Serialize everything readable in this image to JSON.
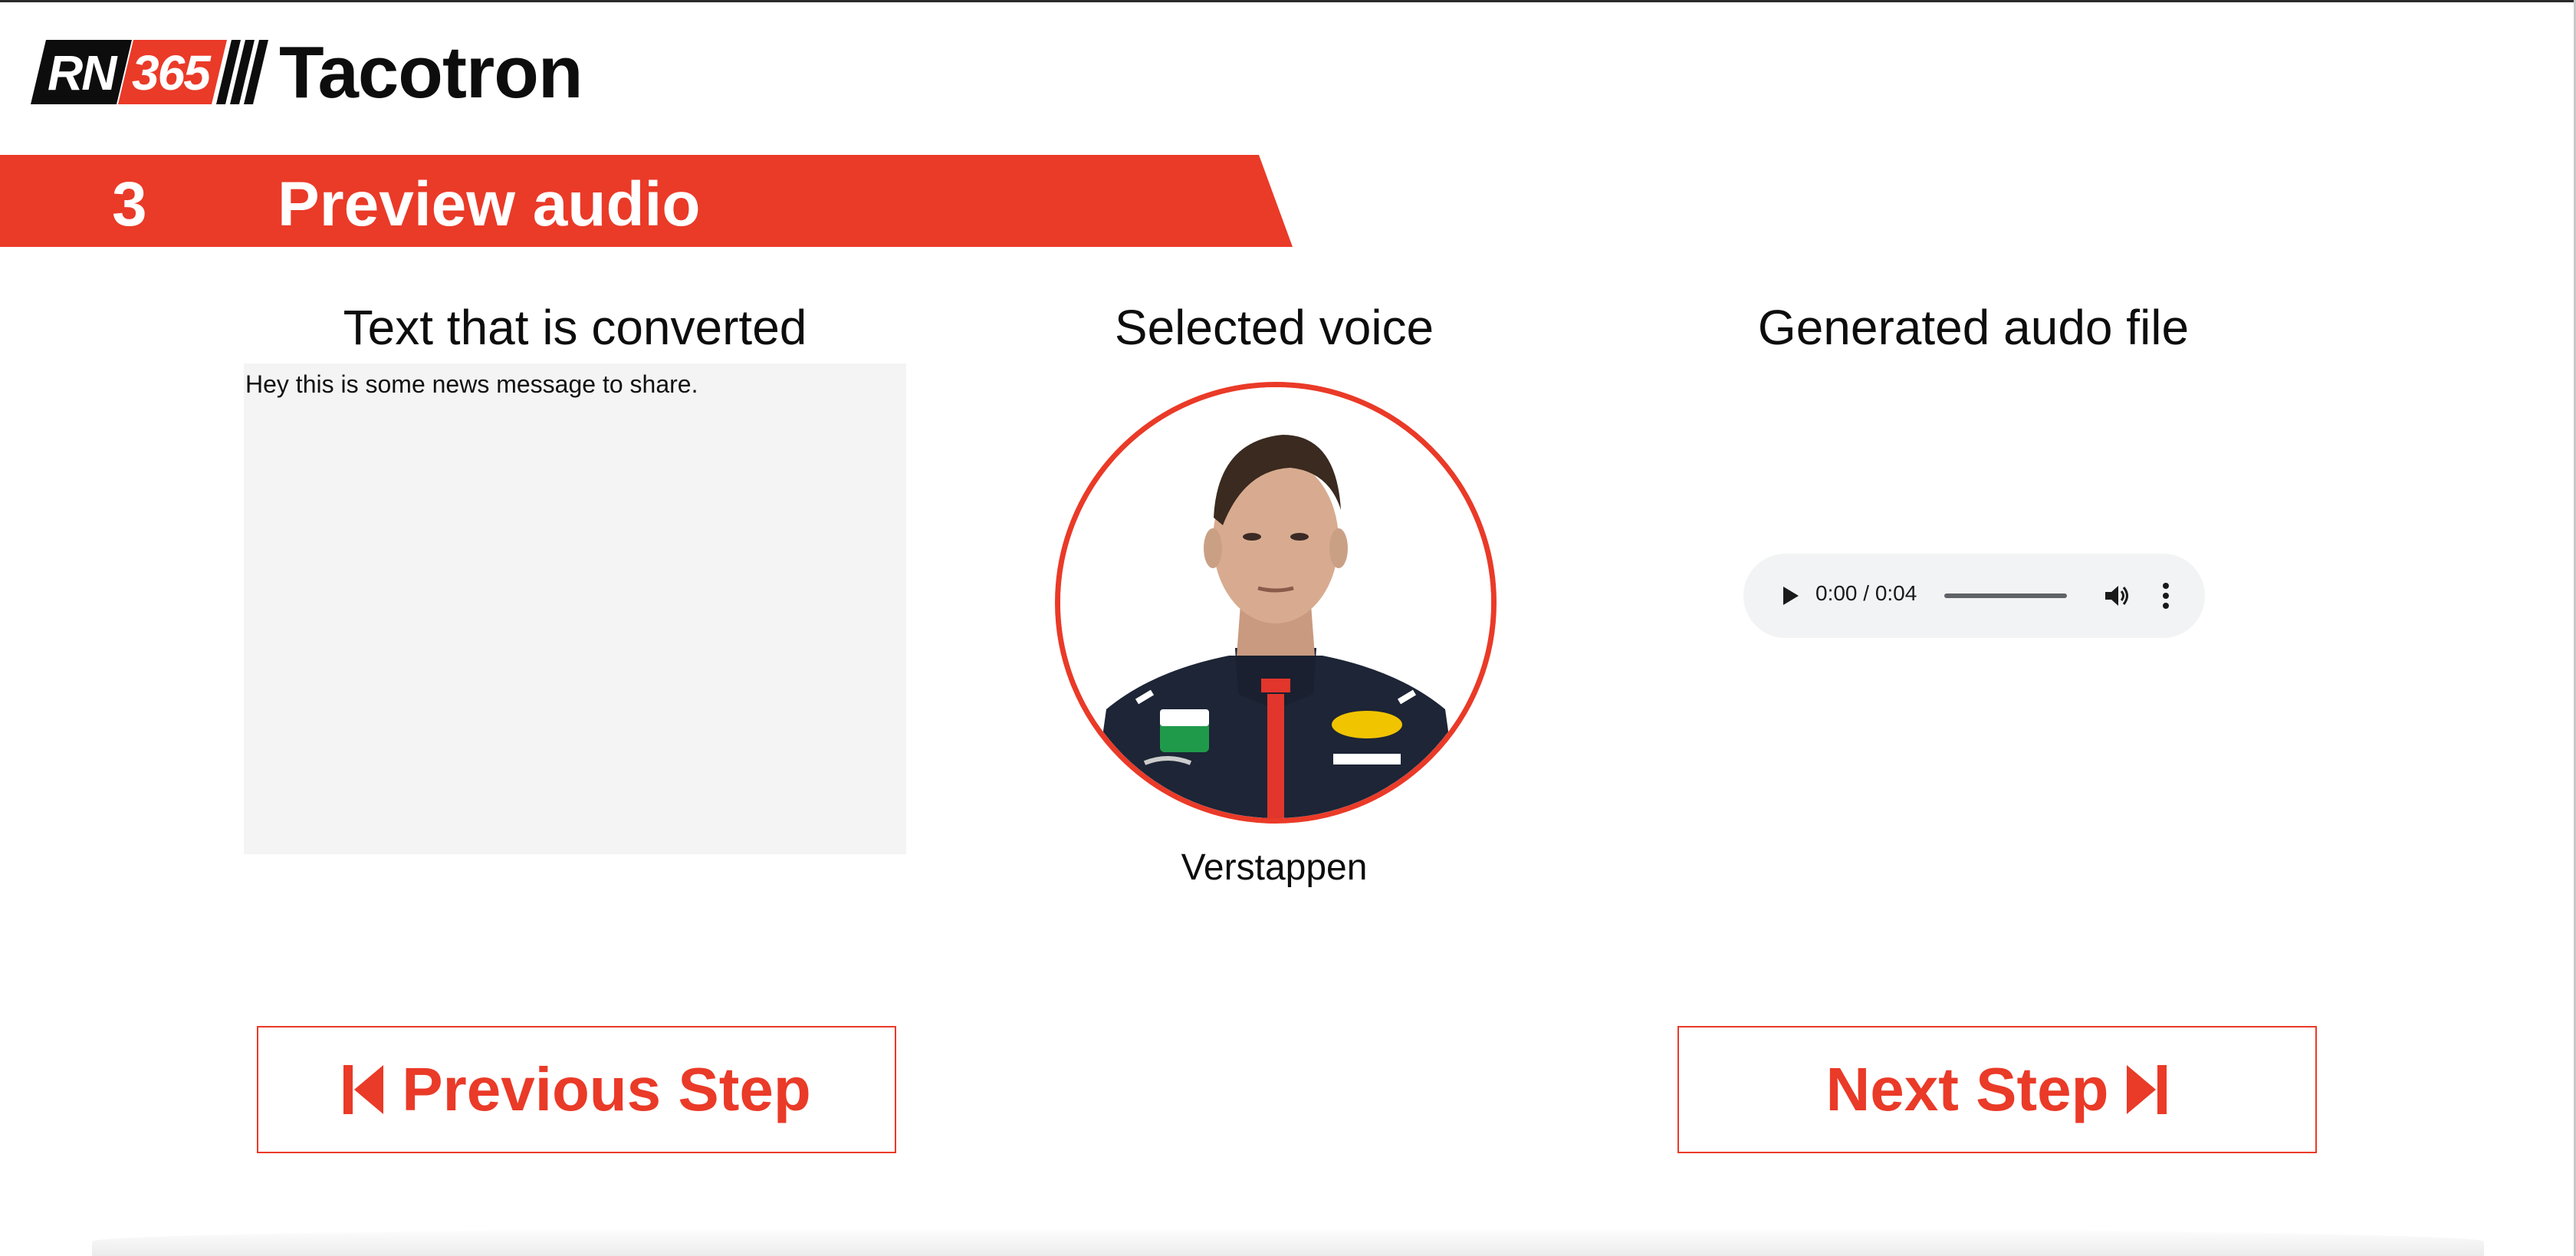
{
  "header": {
    "logo_part1": "RN",
    "logo_part2": "365",
    "app_title": "Tacotron"
  },
  "step": {
    "number": "3",
    "title": "Preview audio"
  },
  "columns": {
    "text_heading": "Text that is converted",
    "voice_heading": "Selected voice",
    "audio_heading": "Generated audo file"
  },
  "text_input": {
    "value": "Hey this is some news message to share."
  },
  "voice": {
    "name": "Verstappen"
  },
  "audio_player": {
    "time": "0:00 / 0:04",
    "progress": 0
  },
  "navigation": {
    "previous_label": "Previous Step",
    "next_label": "Next Step"
  },
  "colors": {
    "accent": "#ea3a28",
    "text": "#0d0d0d",
    "text_box_bg": "#f4f4f4",
    "player_bg": "#f1f3f4"
  }
}
